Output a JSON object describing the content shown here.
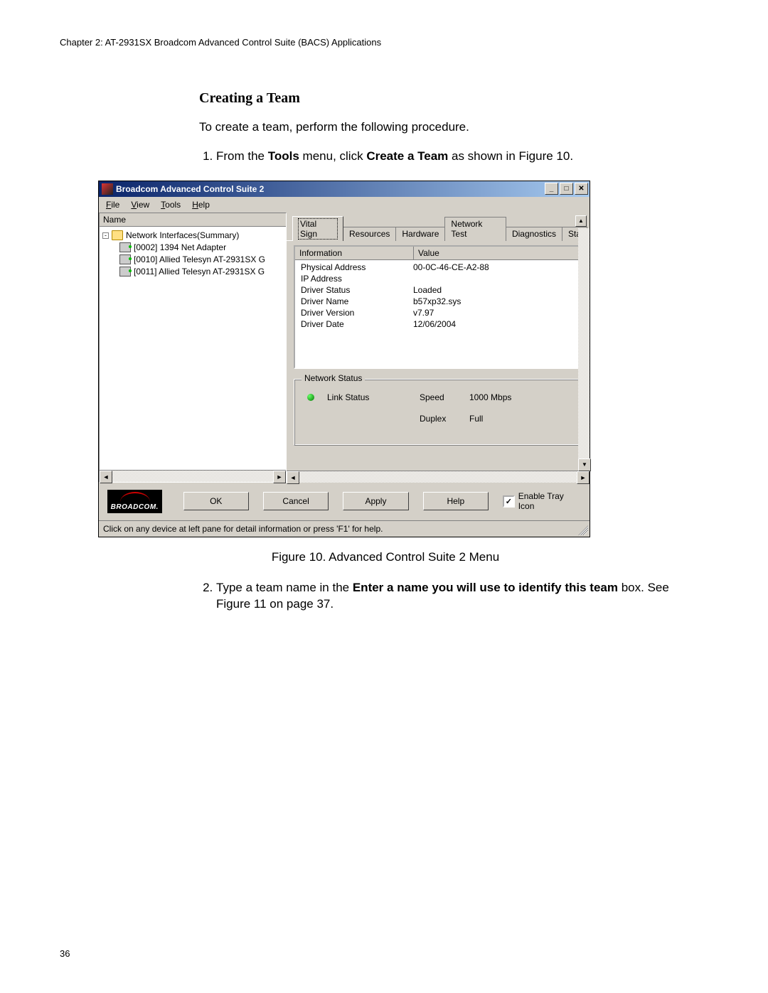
{
  "doc": {
    "chapter_header": "Chapter 2: AT-2931SX Broadcom Advanced Control Suite (BACS) Applications",
    "section_title": "Creating a Team",
    "intro": "To create a team, perform the following procedure.",
    "step1_pre": "From the ",
    "step1_bold1": "Tools",
    "step1_mid": " menu, click ",
    "step1_bold2": "Create a Team",
    "step1_post": " as shown in Figure 10.",
    "figure_caption": "Figure 10. Advanced Control Suite 2 Menu",
    "step2_pre": "Type a team name in the ",
    "step2_bold": "Enter a name you will use to identify this team",
    "step2_post": " box. See Figure 11 on page 37.",
    "page_number": "36"
  },
  "app": {
    "title": "Broadcom Advanced Control Suite 2",
    "menus": {
      "file": "File",
      "view": "View",
      "tools": "Tools",
      "help": "Help"
    },
    "left": {
      "header": "Name",
      "root": "Network Interfaces(Summary)",
      "items": [
        "[0002] 1394 Net Adapter",
        "[0010] Allied Telesyn AT-2931SX G",
        "[0011] Allied Telesyn AT-2931SX G"
      ]
    },
    "tabs": {
      "vital_sign": "Vital Sign",
      "resources": "Resources",
      "hardware": "Hardware",
      "network_test": "Network Test",
      "diagnostics": "Diagnostics",
      "sta": "Sta"
    },
    "info": {
      "col1": "Information",
      "col2": "Value",
      "rows": [
        {
          "k": "Physical Address",
          "v": "00-0C-46-CE-A2-88"
        },
        {
          "k": "IP Address",
          "v": ""
        },
        {
          "k": "Driver Status",
          "v": "Loaded"
        },
        {
          "k": "Driver Name",
          "v": "b57xp32.sys"
        },
        {
          "k": "Driver Version",
          "v": "v7.97"
        },
        {
          "k": "Driver Date",
          "v": "12/06/2004"
        }
      ]
    },
    "network_status": {
      "legend": "Network Status",
      "link_status_label": "Link Status",
      "speed_label": "Speed",
      "speed_value": "1000  Mbps",
      "duplex_label": "Duplex",
      "duplex_value": "Full"
    },
    "buttons": {
      "logo": "BROADCOM.",
      "ok": "OK",
      "cancel": "Cancel",
      "apply": "Apply",
      "help": "Help",
      "enable_tray": "Enable Tray Icon",
      "enable_tray_checked": "✓"
    },
    "statusbar": "Click on any device at left pane for detail information or press 'F1' for help."
  }
}
